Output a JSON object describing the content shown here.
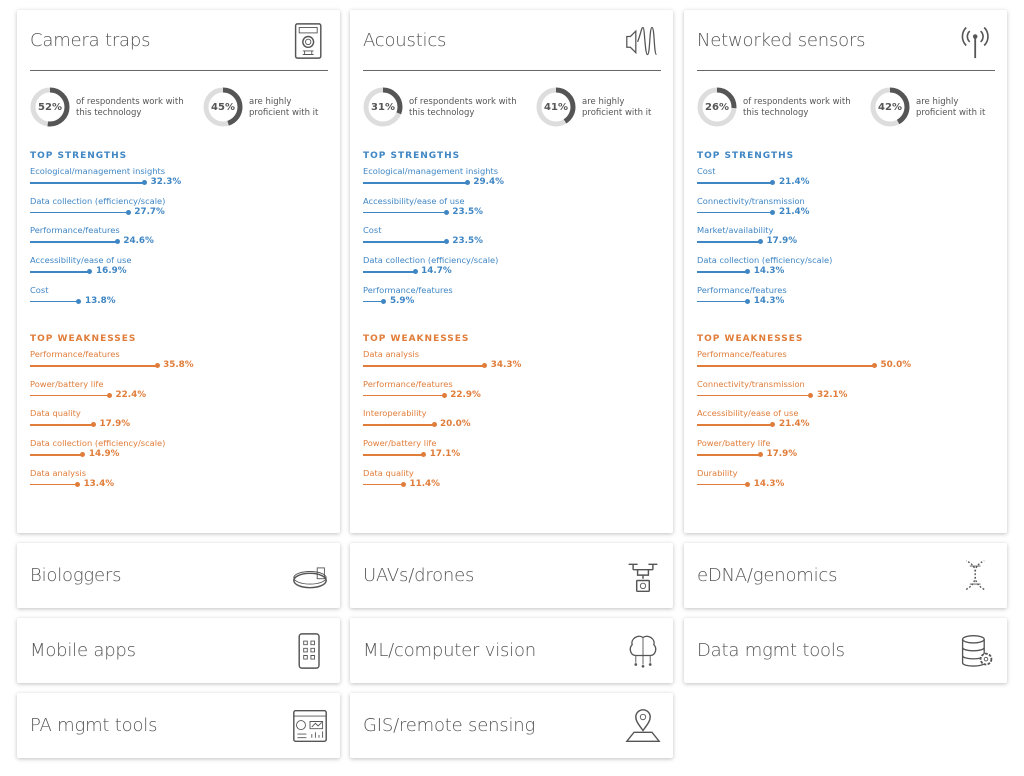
{
  "colors": {
    "strength": "#3f86c4",
    "weakness": "#e07d3a",
    "ring": "#555555",
    "ring_bg": "#dddddd"
  },
  "labels": {
    "work_with": "of respondents work with this technology",
    "proficient": "are highly proficient with it",
    "top_strengths": "TOP STRENGTHS",
    "top_weaknesses": "TOP WEAKNESSES"
  },
  "detail_cards": [
    {
      "title": "Camera traps",
      "icon": "camera-trap-icon",
      "work_pct": 52,
      "work_label": "52%",
      "prof_pct": 45,
      "prof_label": "45%",
      "strengths": [
        {
          "label": "Ecological/management insights",
          "value": 32.3,
          "text": "32.3%"
        },
        {
          "label": "Data collection (efficiency/scale)",
          "value": 27.7,
          "text": "27.7%"
        },
        {
          "label": "Performance/features",
          "value": 24.6,
          "text": "24.6%"
        },
        {
          "label": "Accessibility/ease of use",
          "value": 16.9,
          "text": "16.9%"
        },
        {
          "label": "Cost",
          "value": 13.8,
          "text": "13.8%"
        }
      ],
      "weaknesses": [
        {
          "label": "Performance/features",
          "value": 35.8,
          "text": "35.8%"
        },
        {
          "label": "Power/battery life",
          "value": 22.4,
          "text": "22.4%"
        },
        {
          "label": "Data quality",
          "value": 17.9,
          "text": "17.9%"
        },
        {
          "label": "Data collection (efficiency/scale)",
          "value": 14.9,
          "text": "14.9%"
        },
        {
          "label": "Data analysis",
          "value": 13.4,
          "text": "13.4%"
        }
      ]
    },
    {
      "title": "Acoustics",
      "icon": "sound-wave-icon",
      "work_pct": 31,
      "work_label": "31%",
      "prof_pct": 41,
      "prof_label": "41%",
      "strengths": [
        {
          "label": "Ecological/management insights",
          "value": 29.4,
          "text": "29.4%"
        },
        {
          "label": "Accessibility/ease of use",
          "value": 23.5,
          "text": "23.5%"
        },
        {
          "label": "Cost",
          "value": 23.5,
          "text": "23.5%"
        },
        {
          "label": "Data collection (efficiency/scale)",
          "value": 14.7,
          "text": "14.7%"
        },
        {
          "label": "Performance/features",
          "value": 5.9,
          "text": "5.9%"
        }
      ],
      "weaknesses": [
        {
          "label": "Data analysis",
          "value": 34.3,
          "text": "34.3%"
        },
        {
          "label": "Performance/features",
          "value": 22.9,
          "text": "22.9%"
        },
        {
          "label": "Interoperability",
          "value": 20.0,
          "text": "20.0%"
        },
        {
          "label": "Power/battery life",
          "value": 17.1,
          "text": "17.1%"
        },
        {
          "label": "Data quality",
          "value": 11.4,
          "text": "11.4%"
        }
      ]
    },
    {
      "title": "Networked sensors",
      "icon": "antenna-icon",
      "work_pct": 26,
      "work_label": "26%",
      "prof_pct": 42,
      "prof_label": "42%",
      "strengths": [
        {
          "label": "Cost",
          "value": 21.4,
          "text": "21.4%"
        },
        {
          "label": "Connectivity/transmission",
          "value": 21.4,
          "text": "21.4%"
        },
        {
          "label": "Market/availability",
          "value": 17.9,
          "text": "17.9%"
        },
        {
          "label": "Data collection (efficiency/scale)",
          "value": 14.3,
          "text": "14.3%"
        },
        {
          "label": "Performance/features",
          "value": 14.3,
          "text": "14.3%"
        }
      ],
      "weaknesses": [
        {
          "label": "Performance/features",
          "value": 50.0,
          "text": "50.0%"
        },
        {
          "label": "Connectivity/transmission",
          "value": 32.1,
          "text": "32.1%"
        },
        {
          "label": "Accessibility/ease of use",
          "value": 21.4,
          "text": "21.4%"
        },
        {
          "label": "Power/battery life",
          "value": 17.9,
          "text": "17.9%"
        },
        {
          "label": "Durability",
          "value": 14.3,
          "text": "14.3%"
        }
      ]
    }
  ],
  "summary_cards": [
    {
      "title": "Biologgers",
      "icon": "collar-tag-icon"
    },
    {
      "title": "UAVs/drones",
      "icon": "drone-icon"
    },
    {
      "title": "eDNA/genomics",
      "icon": "dna-icon"
    },
    {
      "title": "Mobile apps",
      "icon": "smartphone-icon"
    },
    {
      "title": "ML/computer vision",
      "icon": "brain-circuit-icon"
    },
    {
      "title": "Data mgmt tools",
      "icon": "database-gear-icon"
    },
    {
      "title": "PA mgmt tools",
      "icon": "dashboard-icon"
    },
    {
      "title": "GIS/remote sensing",
      "icon": "map-pin-icon"
    }
  ]
}
